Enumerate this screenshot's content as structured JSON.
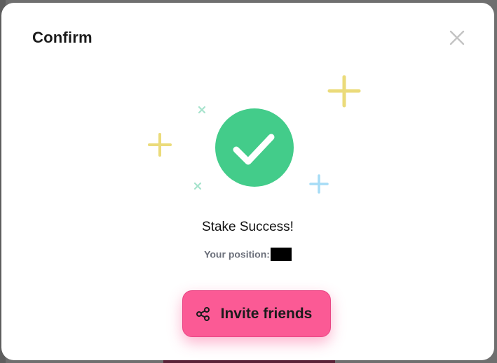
{
  "modal": {
    "title": "Confirm",
    "status_text": "Stake Success!",
    "position_label": "Your position:",
    "position_value": "",
    "invite_label": "Invite friends"
  },
  "icons": {
    "close": "close-icon",
    "success": "check-circle-icon",
    "share": "share-icon",
    "decorations": [
      "plus-icon",
      "cross-icon"
    ]
  },
  "colors": {
    "success": "#43cc8a",
    "accent": "#fb5a95",
    "sparkle_yellow": "#ebdb7a",
    "sparkle_blue": "#a6dcf6",
    "sparkle_green": "#a6e3cc"
  }
}
